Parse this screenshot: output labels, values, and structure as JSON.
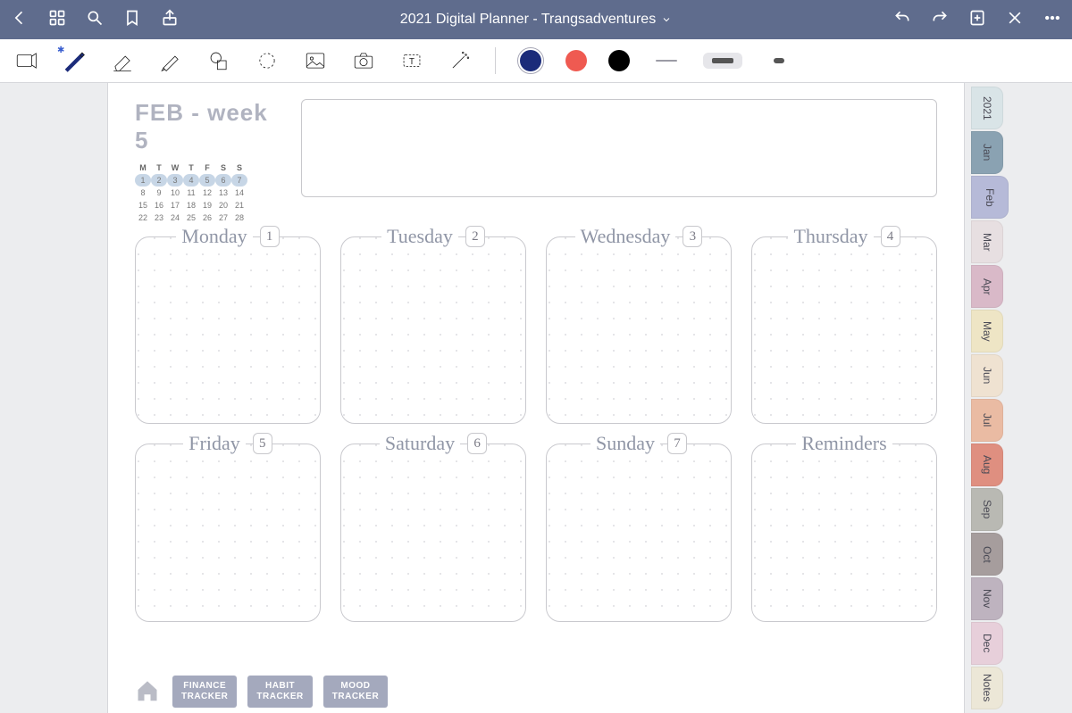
{
  "titlebar": {
    "title": "2021 Digital Planner - Trangsadventures"
  },
  "page": {
    "month_label": "FEB - week 5",
    "mini_cal": {
      "dow": [
        "M",
        "T",
        "W",
        "T",
        "F",
        "S",
        "S"
      ],
      "rows": [
        [
          "1",
          "2",
          "3",
          "4",
          "5",
          "6",
          "7"
        ],
        [
          "8",
          "9",
          "10",
          "11",
          "12",
          "13",
          "14"
        ],
        [
          "15",
          "16",
          "17",
          "18",
          "19",
          "20",
          "21"
        ],
        [
          "22",
          "23",
          "24",
          "25",
          "26",
          "27",
          "28"
        ]
      ],
      "highlight_row": 0
    },
    "days": [
      {
        "name": "Monday",
        "num": "1"
      },
      {
        "name": "Tuesday",
        "num": "2"
      },
      {
        "name": "Wednesday",
        "num": "3"
      },
      {
        "name": "Thursday",
        "num": "4"
      },
      {
        "name": "Friday",
        "num": "5"
      },
      {
        "name": "Saturday",
        "num": "6"
      },
      {
        "name": "Sunday",
        "num": "7"
      },
      {
        "name": "Reminders",
        "num": ""
      }
    ],
    "trackers": [
      {
        "l1": "FINANCE",
        "l2": "TRACKER"
      },
      {
        "l1": "HABIT",
        "l2": "TRACKER"
      },
      {
        "l1": "MOOD",
        "l2": "TRACKER"
      }
    ],
    "tabs": [
      {
        "label": "2021",
        "bg": "#d9e4e7"
      },
      {
        "label": "Jan",
        "bg": "#8aa2b2"
      },
      {
        "label": "Feb",
        "bg": "#b6bad8",
        "active": true
      },
      {
        "label": "Mar",
        "bg": "#e7dfe1"
      },
      {
        "label": "Apr",
        "bg": "#d9b9c8"
      },
      {
        "label": "May",
        "bg": "#eee5c5"
      },
      {
        "label": "Jun",
        "bg": "#efe2d1"
      },
      {
        "label": "Jul",
        "bg": "#eabba3"
      },
      {
        "label": "Aug",
        "bg": "#df8f80"
      },
      {
        "label": "Sep",
        "bg": "#b9b9b3"
      },
      {
        "label": "Oct",
        "bg": "#a69d9d"
      },
      {
        "label": "Nov",
        "bg": "#beb3bf"
      },
      {
        "label": "Dec",
        "bg": "#e7cfda"
      },
      {
        "label": "Notes",
        "bg": "#ece7d7"
      }
    ]
  },
  "colors": {
    "selected": "#1b2b7a",
    "red": "#ef5a51",
    "black": "#000000"
  }
}
